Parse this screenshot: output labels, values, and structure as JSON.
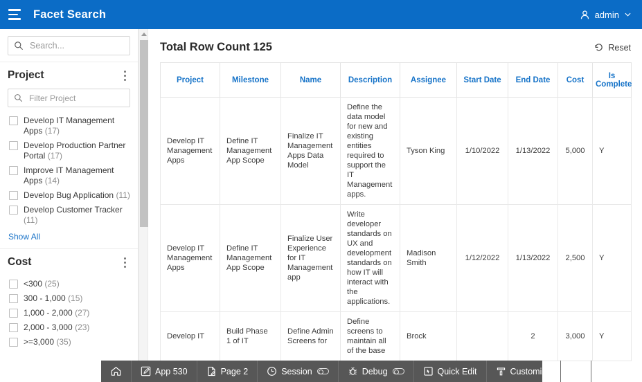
{
  "appbar": {
    "menu_icon": "hamburger-icon",
    "title": "Facet Search",
    "user_icon": "user-icon",
    "user_label": "admin",
    "chevron": "⌄"
  },
  "sidebar": {
    "search": {
      "placeholder": "Search...",
      "value": "",
      "icon": "search-icon"
    },
    "facets": [
      {
        "title": "Project",
        "menu_icon": "kebab-menu-icon",
        "filter": {
          "placeholder": "Filter Project",
          "value": "",
          "icon": "search-icon"
        },
        "items": [
          {
            "label": "Develop IT Management Apps",
            "count": "(17)",
            "checked": false
          },
          {
            "label": "Develop Production Partner Portal",
            "count": "(17)",
            "checked": false
          },
          {
            "label": "Improve IT Management Apps",
            "count": "(14)",
            "checked": false
          },
          {
            "label": "Develop Bug Application",
            "count": "(11)",
            "checked": false
          },
          {
            "label": "Develop Customer Tracker",
            "count": "(11)",
            "checked": false
          }
        ],
        "show_all": "Show All"
      },
      {
        "title": "Cost",
        "menu_icon": "kebab-menu-icon",
        "items": [
          {
            "label": "<300",
            "count": "(25)",
            "checked": false
          },
          {
            "label": "300 - 1,000",
            "count": "(15)",
            "checked": false
          },
          {
            "label": "1,000 - 2,000",
            "count": "(27)",
            "checked": false
          },
          {
            "label": "2,000 - 3,000",
            "count": "(23)",
            "checked": false
          },
          {
            "label": ">=3,000",
            "count": "(35)",
            "checked": false
          }
        ]
      }
    ]
  },
  "main": {
    "page_title": "Total Row Count 125",
    "reset_label": "Reset",
    "reset_icon": "undo-icon",
    "table": {
      "columns": [
        "Project",
        "Milestone",
        "Name",
        "Description",
        "Assignee",
        "Start Date",
        "End Date",
        "Cost",
        "Is Complete"
      ],
      "rows": [
        {
          "project": "Develop IT Management Apps",
          "milestone": "Define IT Management App Scope",
          "name": "Finalize IT Management Apps Data Model",
          "description": "Define the data model for new and existing entities required to support the IT Management apps.",
          "assignee": "Tyson King",
          "start_date": "1/10/2022",
          "end_date": "1/13/2022",
          "cost": "5,000",
          "is_complete": "Y"
        },
        {
          "project": "Develop IT Management Apps",
          "milestone": "Define IT Management App Scope",
          "name": "Finalize User Experience for IT Management app",
          "description": "Write developer standards on UX and development standards on how IT will interact with the applications.",
          "assignee": "Madison Smith",
          "start_date": "1/12/2022",
          "end_date": "1/13/2022",
          "cost": "2,500",
          "is_complete": "Y"
        },
        {
          "project": "Develop IT",
          "milestone": "Build Phase 1 of IT",
          "name": "Define Admin Screens for",
          "description": "Define screens to maintain all of the base",
          "assignee": "Brock",
          "start_date": "",
          "end_date": "2",
          "cost": "3,000",
          "is_complete": "Y"
        }
      ]
    }
  },
  "devbar": {
    "items": [
      {
        "label": "",
        "icon": "home-icon",
        "toggle": false
      },
      {
        "label": "App 530",
        "icon": "edit-app-icon",
        "toggle": false
      },
      {
        "label": "Page 2",
        "icon": "page-icon",
        "toggle": false
      },
      {
        "label": "Session",
        "icon": "clock-icon",
        "toggle": true
      },
      {
        "label": "Debug",
        "icon": "bug-icon",
        "toggle": true
      },
      {
        "label": "Quick Edit",
        "icon": "quick-edit-icon",
        "toggle": false
      },
      {
        "label": "Customize",
        "icon": "brush-icon",
        "toggle": false
      },
      {
        "label": "",
        "icon": "info-icon",
        "toggle": false
      },
      {
        "label": "",
        "icon": "gear-icon",
        "toggle": false
      }
    ]
  },
  "colors": {
    "brand_blue": "#0b6cc6",
    "header_text_blue": "#1673c8",
    "link_blue": "#1a73c8",
    "devbar_gray": "#575757"
  }
}
